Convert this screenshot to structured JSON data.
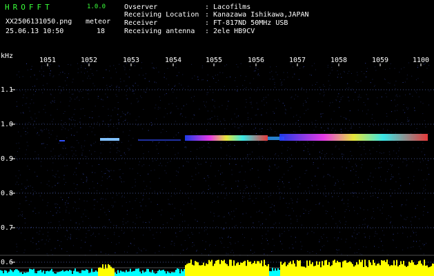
{
  "header": {
    "app_title": "HROFFT",
    "app_version": "1.0.0",
    "filename": "XX2506131050.png",
    "datetime": "25.06.13 10:50",
    "meteor_label": "meteor",
    "meteor_count": "18"
  },
  "info": [
    {
      "key": "Ovserver",
      "value": ": Lacofilms"
    },
    {
      "key": "Receiving Location",
      "value": ": Kanazawa Ishikawa,JAPAN"
    },
    {
      "key": "Receiver",
      "value": ": FT-817ND 50MHz USB"
    },
    {
      "key": "Receiving antenna",
      "value": ": 2ele HB9CV"
    }
  ],
  "axes": {
    "y_unit": "kHz",
    "time_ticks": [
      "1051",
      "1052",
      "1053",
      "1054",
      "1055",
      "1056",
      "1057",
      "1058",
      "1059",
      "1100"
    ],
    "freq_ticks": [
      "1.1",
      "1.0",
      "0.9",
      "0.8",
      "0.7",
      "0.6"
    ]
  },
  "colors": {
    "background": "#000000",
    "title": "#39ff39",
    "text": "#ffffff",
    "grid": "#40508a",
    "signal_hot": "#ff4040",
    "signal_level": "#ffff00",
    "signal_low": "#00ffff"
  }
}
